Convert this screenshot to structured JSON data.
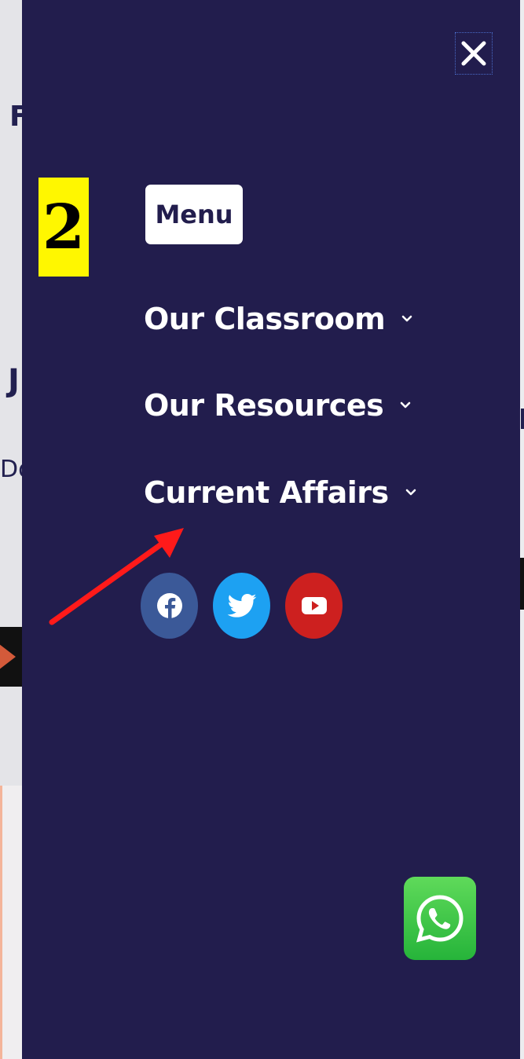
{
  "background_page": {
    "fragment_letter_1": "F",
    "fragment_letter_2": "J",
    "fragment_text": "Do"
  },
  "step_badge": "2",
  "drawer": {
    "menu_label": "Menu",
    "close_icon": "close-icon",
    "nav_items": [
      {
        "label": "Our Classroom",
        "icon": "chevron-down-icon"
      },
      {
        "label": "Our Resources",
        "icon": "chevron-down-icon"
      },
      {
        "label": "Current Affairs",
        "icon": "chevron-down-icon"
      }
    ],
    "social": [
      {
        "name": "facebook-icon",
        "color": "#3b5998"
      },
      {
        "name": "twitter-icon",
        "color": "#1da1f2"
      },
      {
        "name": "youtube-icon",
        "color": "#cd201f"
      }
    ],
    "background_color": "#221d4d"
  },
  "annotation_arrow_color": "#ff1a1a",
  "whatsapp": {
    "icon": "whatsapp-icon",
    "color": "#2fc24a"
  }
}
